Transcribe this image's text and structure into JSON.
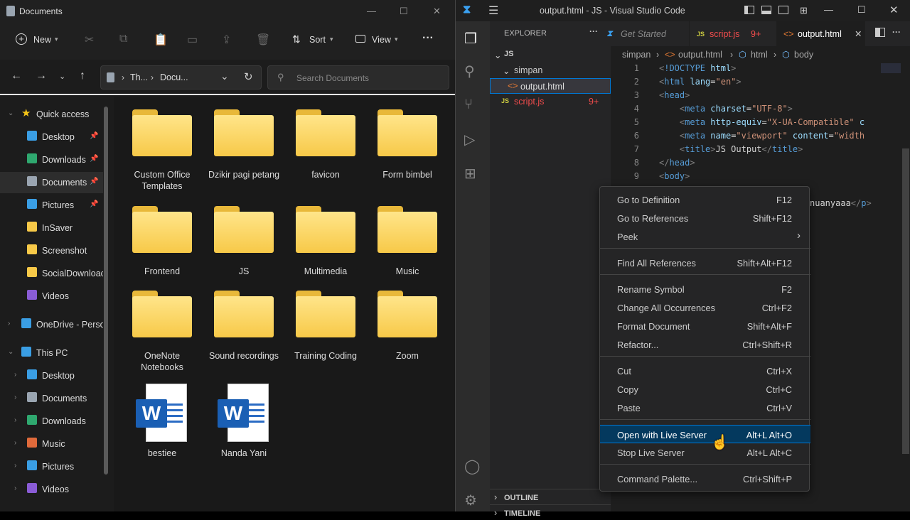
{
  "explorer": {
    "title": "Documents",
    "commands": {
      "new": "New",
      "sort": "Sort",
      "view": "View",
      "more": "···"
    },
    "address": {
      "part1": "Th...",
      "part2": "Docu..."
    },
    "search_placeholder": "Search Documents",
    "nav": [
      {
        "label": "Quick access",
        "icon": "star-icon",
        "color": "#f5c518"
      },
      {
        "label": "Desktop",
        "icon": "desktop-icon",
        "color": "#3a9ee4",
        "pinned": true
      },
      {
        "label": "Downloads",
        "icon": "download-icon",
        "color": "#2fa86f",
        "pinned": true
      },
      {
        "label": "Documents",
        "icon": "document-icon",
        "color": "#9aa5b1",
        "pinned": true
      },
      {
        "label": "Pictures",
        "icon": "pictures-icon",
        "color": "#3a9ee4",
        "pinned": true
      },
      {
        "label": "InSaver",
        "icon": "folder-icon",
        "color": "#f7c948"
      },
      {
        "label": "Screenshot",
        "icon": "folder-icon",
        "color": "#f7c948"
      },
      {
        "label": "SocialDownloac",
        "icon": "folder-icon",
        "color": "#f7c948"
      },
      {
        "label": "Videos",
        "icon": "videos-icon",
        "color": "#8a5cd6"
      },
      {
        "label": "OneDrive - Perso",
        "icon": "cloud-icon",
        "color": "#3a9ee4"
      },
      {
        "label": "This PC",
        "icon": "pc-icon",
        "color": "#3a9ee4"
      },
      {
        "label": "Desktop",
        "icon": "desktop-icon",
        "color": "#3a9ee4"
      },
      {
        "label": "Documents",
        "icon": "document-icon",
        "color": "#9aa5b1"
      },
      {
        "label": "Downloads",
        "icon": "download-icon",
        "color": "#2fa86f"
      },
      {
        "label": "Music",
        "icon": "music-icon",
        "color": "#e06a3b"
      },
      {
        "label": "Pictures",
        "icon": "pictures-icon",
        "color": "#3a9ee4"
      },
      {
        "label": "Videos",
        "icon": "videos-icon",
        "color": "#8a5cd6"
      }
    ],
    "items": [
      {
        "name": "Custom Office Templates",
        "type": "folder"
      },
      {
        "name": "Dzikir pagi petang",
        "type": "folder"
      },
      {
        "name": "favicon",
        "type": "folder"
      },
      {
        "name": "Form bimbel",
        "type": "folder"
      },
      {
        "name": "Frontend",
        "type": "folder"
      },
      {
        "name": "JS",
        "type": "folder"
      },
      {
        "name": "Multimedia",
        "type": "folder"
      },
      {
        "name": "Music",
        "type": "folder"
      },
      {
        "name": "OneNote Notebooks",
        "type": "folder"
      },
      {
        "name": "Sound recordings",
        "type": "folder"
      },
      {
        "name": "Training Coding",
        "type": "folder"
      },
      {
        "name": "Zoom",
        "type": "folder"
      },
      {
        "name": "bestiee",
        "type": "word"
      },
      {
        "name": "Nanda Yani",
        "type": "word"
      }
    ]
  },
  "vscode": {
    "title": "output.html - JS - Visual Studio Code",
    "explorer_label": "EXPLORER",
    "tree": {
      "root": "JS",
      "folder": "simpan",
      "file1": "output.html",
      "file2": "script.js",
      "file2_badge": "9+"
    },
    "tabs": [
      {
        "label": "Get Started"
      },
      {
        "label": "script.js",
        "badge": "9+"
      },
      {
        "label": "output.html"
      }
    ],
    "breadcrumb": [
      "simpan",
      "output.html",
      "html",
      "body"
    ],
    "code_text": {
      "l7": "JS Output",
      "l10": "nuanyaaa"
    },
    "outline": "OUTLINE",
    "timeline": "TIMELINE",
    "context_menu": [
      {
        "label": "Go to Definition",
        "key": "F12"
      },
      {
        "label": "Go to References",
        "key": "Shift+F12"
      },
      {
        "label": "Peek",
        "key": "›"
      },
      {
        "label": "Find All References",
        "key": "Shift+Alt+F12"
      },
      {
        "label": "Rename Symbol",
        "key": "F2"
      },
      {
        "label": "Change All Occurrences",
        "key": "Ctrl+F2"
      },
      {
        "label": "Format Document",
        "key": "Shift+Alt+F"
      },
      {
        "label": "Refactor...",
        "key": "Ctrl+Shift+R"
      },
      {
        "label": "Cut",
        "key": "Ctrl+X"
      },
      {
        "label": "Copy",
        "key": "Ctrl+C"
      },
      {
        "label": "Paste",
        "key": "Ctrl+V"
      },
      {
        "label": "Open with Live Server",
        "key": "Alt+L Alt+O"
      },
      {
        "label": "Stop Live Server",
        "key": "Alt+L Alt+C"
      },
      {
        "label": "Command Palette...",
        "key": "Ctrl+Shift+P"
      }
    ]
  }
}
